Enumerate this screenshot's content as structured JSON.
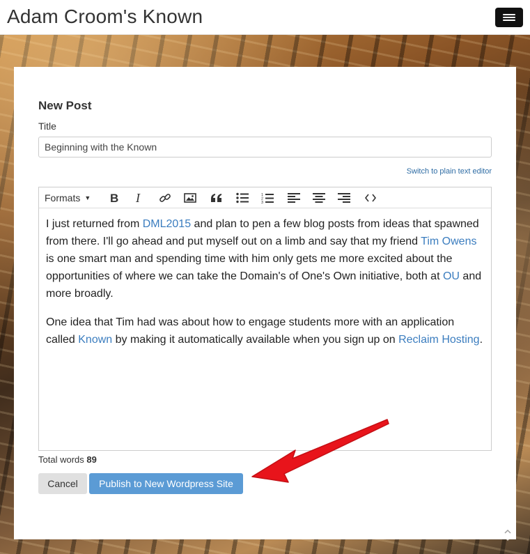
{
  "site": {
    "title": "Adam Croom's Known"
  },
  "header": {
    "menu_icon": "hamburger-icon"
  },
  "form": {
    "heading": "New Post",
    "title_label": "Title",
    "title_value": "Beginning with the Known",
    "switch_editor_label": "Switch to plain text editor"
  },
  "toolbar": {
    "formats_label": "Formats",
    "buttons": [
      "bold-icon",
      "italic-icon",
      "link-icon",
      "image-icon",
      "blockquote-icon",
      "bullet-list-icon",
      "numbered-list-icon",
      "align-left-icon",
      "align-center-icon",
      "align-right-icon",
      "code-icon"
    ]
  },
  "content": {
    "p1": {
      "t1": "I just returned from ",
      "link1": "DML2015",
      "t2": " and plan to pen a few blog posts from ideas that spawned from there. I'll go ahead and put myself out on a limb and say that my friend ",
      "link2": "Tim Owens",
      "t3": " is one smart man and spending time with him only gets me more excited about the opportunities of where we can take the Domain's of One's Own initiative, both at ",
      "link3": "OU",
      "t4": " and more broadly."
    },
    "p2": {
      "t1": "One idea that Tim had was about how to engage students more with an application called ",
      "link1": "Known",
      "t2": " by making it automatically available when you sign up on ",
      "link2": "Reclaim Hosting",
      "t3": "."
    }
  },
  "footer": {
    "word_count_label": "Total words",
    "word_count": "89",
    "cancel_label": "Cancel",
    "publish_label": "Publish to New Wordpress Site"
  },
  "colors": {
    "link": "#3b7dbf",
    "publish_button": "#5b9bd5",
    "annotation_arrow": "#e8141b"
  }
}
